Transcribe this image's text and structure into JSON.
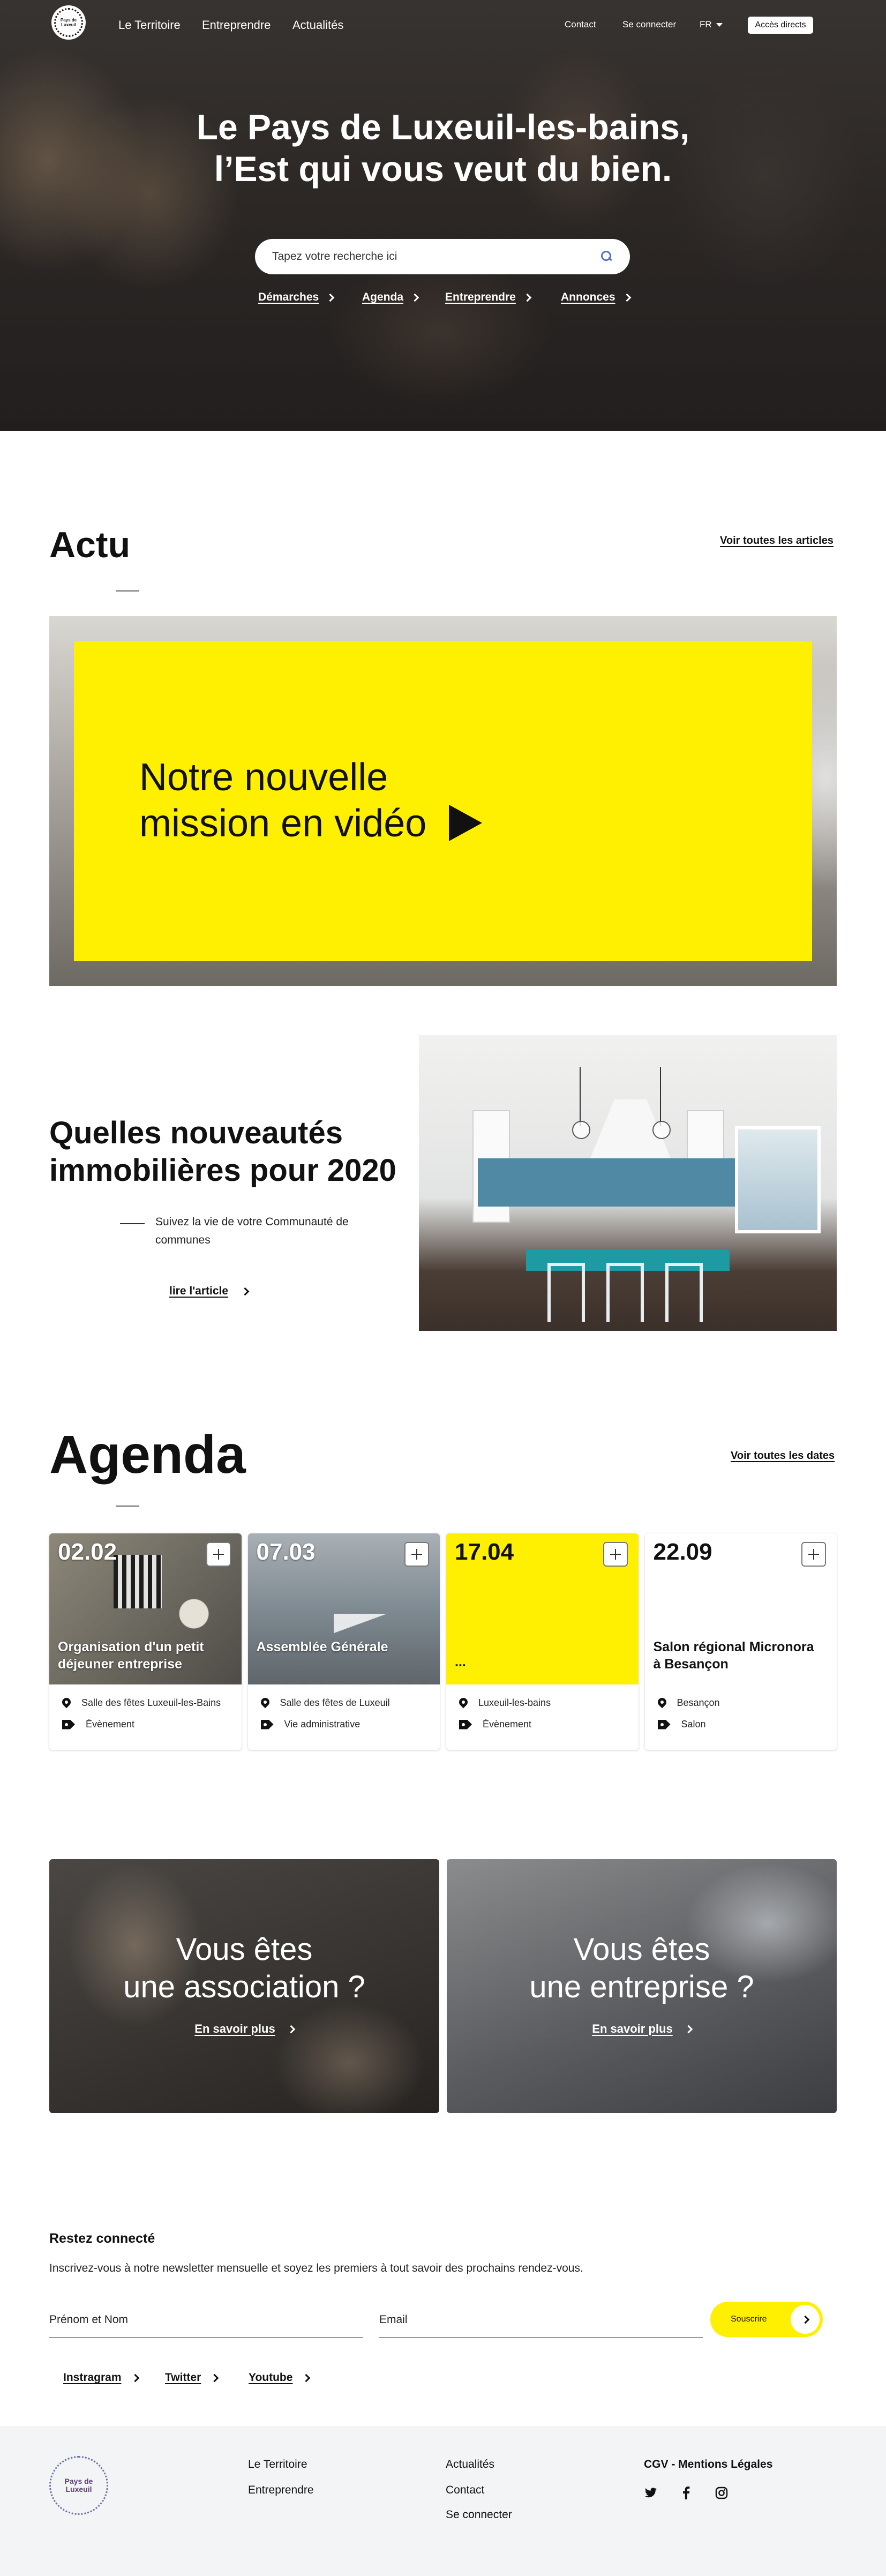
{
  "header": {
    "logo_text": "Pays de Luxeuil",
    "nav": [
      "Le Territoire",
      "Entreprendre",
      "Actualités"
    ],
    "utility": [
      "Contact",
      "Se connecter"
    ],
    "lang": "FR",
    "access_button": "Accès directs"
  },
  "hero": {
    "title_line1": "Le Pays de Luxeuil-les-bains,",
    "title_line2": "l’Est qui vous veut du bien.",
    "search_placeholder": "Tapez votre recherche ici",
    "quick_links": [
      "Démarches",
      "Agenda",
      "Entreprendre",
      "Annonces"
    ]
  },
  "actu": {
    "title": "Actu",
    "see_all": "Voir toutes les articles",
    "video_title": "Notre nouvelle mission en vidéo",
    "article": {
      "title": "Quelles nouveautés immobilières pour 2020",
      "subtitle": "Suivez la vie de votre Communauté de communes",
      "link": "lire l'article"
    }
  },
  "agenda": {
    "title": "Agenda",
    "see_all": "Voir toutes les dates",
    "events": [
      {
        "date": "02.02",
        "title": "Organisation d'un petit déjeuner entreprise",
        "place": "Salle des  fêtes Luxeuil-les-Bains",
        "category": "Évènement"
      },
      {
        "date": "07.03",
        "title": "Assemblée Générale",
        "place": "Salle des fêtes de Luxeuil",
        "category": "Vie administrative"
      },
      {
        "date": "17.04",
        "title": "...",
        "place": "Luxeuil-les-bains",
        "category": "Évènement"
      },
      {
        "date": "22.09",
        "title": "Salon régional Micronora à Besançon",
        "place": "Besançon",
        "category": "Salon"
      }
    ]
  },
  "cta": [
    {
      "line1": "Vous êtes",
      "line2": "une association ?",
      "link": "En savoir plus"
    },
    {
      "line1": "Vous êtes",
      "line2": "une entreprise ?",
      "link": "En savoir plus"
    }
  ],
  "newsletter": {
    "title": "Restez connecté",
    "text": "Inscrivez-vous à notre newsletter mensuelle et soyez les premiers à tout savoir des prochains rendez-vous.",
    "name_placeholder": "Prénom et Nom",
    "email_placeholder": "Email",
    "submit": "Souscrire",
    "social": [
      "Instragram",
      "Twitter",
      "Youtube"
    ]
  },
  "footer": {
    "logo_text": "Pays de Luxeuil",
    "col1": [
      "Le Territoire",
      "Entreprendre"
    ],
    "col2": [
      "Actualités",
      "Contact",
      "Se connecter"
    ],
    "legal": "CGV - Mentions Légales",
    "icons": [
      "twitter-icon",
      "facebook-icon",
      "instagram-icon"
    ]
  },
  "colors": {
    "accent_yellow": "#ffef00",
    "footer_bg": "#f3f4f5",
    "text": "#111111"
  }
}
